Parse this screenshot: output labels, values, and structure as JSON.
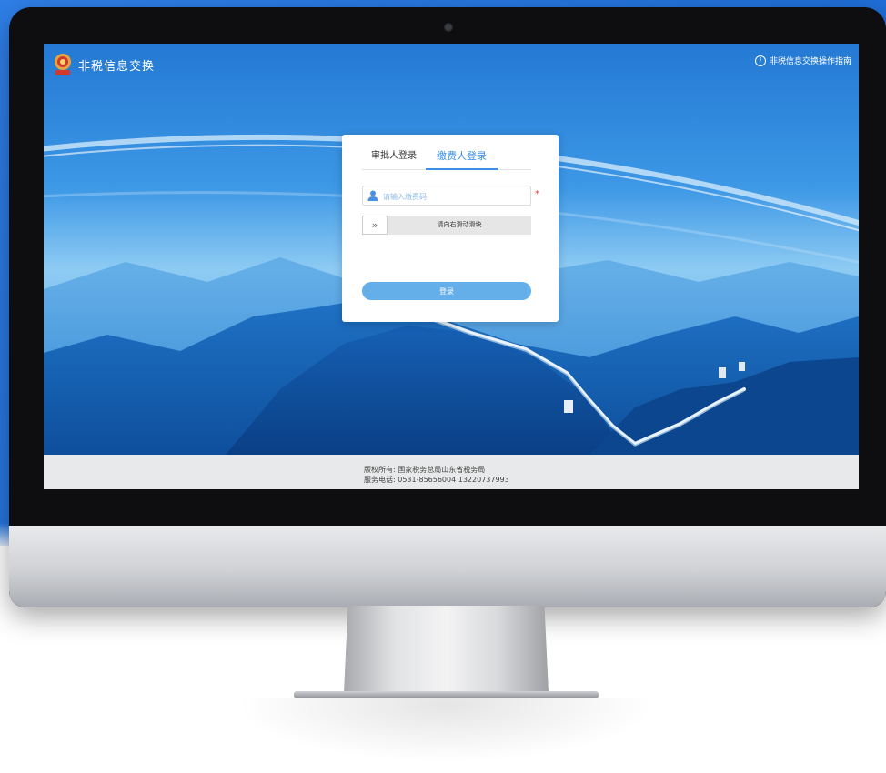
{
  "header": {
    "brand": "非税信息交换",
    "help_link": "非税信息交换操作指南"
  },
  "login": {
    "tabs": [
      {
        "label": "审批人登录",
        "active": false
      },
      {
        "label": "缴费人登录",
        "active": true
      }
    ],
    "username_placeholder": "请输入缴费码",
    "required_mark": "*",
    "slider_handle": "»",
    "slider_text": "请向右滑动滑块",
    "submit_label": "登录"
  },
  "footer": {
    "copyright": "版权所有: 国家税务总局山东省税务局",
    "phone": "服务电话: 0531-85656004 13220737993"
  },
  "colors": {
    "backdrop": "#2f7fe8",
    "accent": "#3b8fe4",
    "button": "#64aee9",
    "required": "#e23a3a",
    "footer_bg": "#e8e9ea"
  }
}
